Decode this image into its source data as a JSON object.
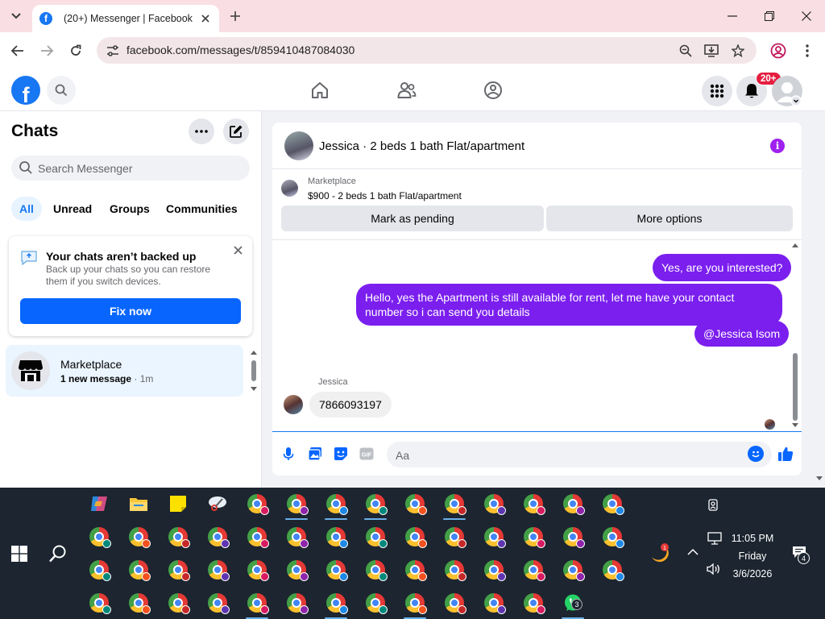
{
  "browser": {
    "tab_title": "(20+) Messenger | Facebook",
    "url": "facebook.com/messages/t/859410487084030"
  },
  "fb_header": {
    "logo_letter": "f",
    "notification_badge": "20+"
  },
  "chats_panel": {
    "title": "Chats",
    "search_placeholder": "Search Messenger",
    "filters": [
      {
        "label": "All",
        "active": true
      },
      {
        "label": "Unread",
        "active": false
      },
      {
        "label": "Groups",
        "active": false
      },
      {
        "label": "Communities",
        "active": false
      }
    ],
    "backup_card": {
      "title": "Your chats aren’t backed up",
      "text": "Back up your chats so you can restore them if you switch devices.",
      "button": "Fix now"
    },
    "conversations": [
      {
        "name": "Marketplace",
        "preview": "1 new message",
        "time": "1m"
      }
    ]
  },
  "conversation": {
    "header_title": "Jessica · 2 beds 1 bath Flat/apartment",
    "marketplace": {
      "label": "Marketplace",
      "listing": "$900 - 2 beds 1 bath Flat/apartment",
      "buttons": [
        "Mark as pending",
        "More options"
      ]
    },
    "messages": [
      {
        "from": "me",
        "text": "Yes, are you interested?"
      },
      {
        "from": "me",
        "text": "Hello, yes the Apartment is still available for rent, let me have your contact number so i can send you details"
      },
      {
        "from": "me",
        "text": "@Jessica Isom"
      },
      {
        "from": "Jessica",
        "text": "7866093197"
      }
    ],
    "sender_label": "Jessica",
    "composer_placeholder": "Aa"
  },
  "taskbar": {
    "time": "11:05 PM",
    "day": "Friday",
    "date": "3/6/2026",
    "whatsapp_badge": "3",
    "notification_count": "4",
    "weather_badge": "1"
  },
  "colors": {
    "facebook_blue": "#1877f2",
    "message_purple": "#7b1fef",
    "tab_bar": "#f9dfe3",
    "taskbar": "#1c2530"
  }
}
